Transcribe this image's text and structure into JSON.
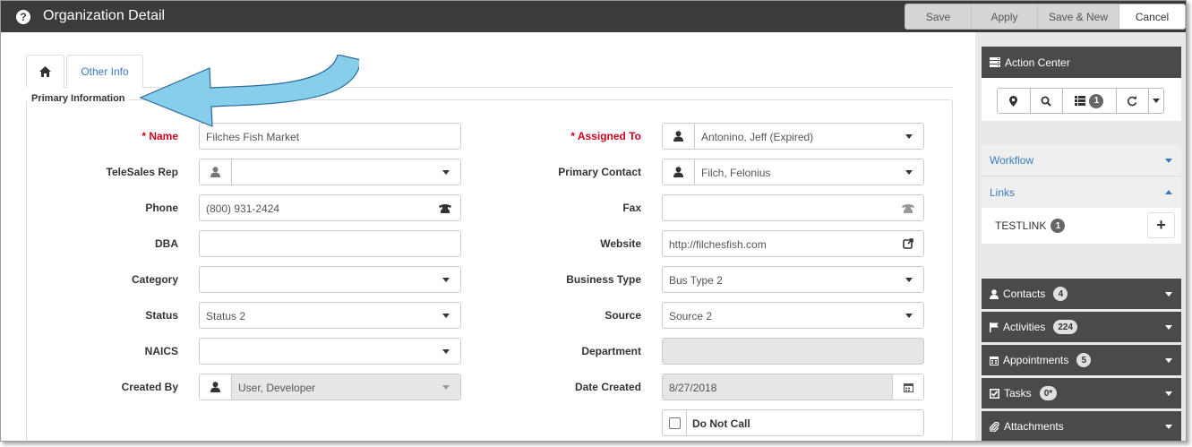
{
  "window": {
    "title": "Organization Detail"
  },
  "toolbar": {
    "save_label": "Save",
    "apply_label": "Apply",
    "save_new_label": "Save & New",
    "cancel_label": "Cancel"
  },
  "tabs": [
    {
      "icon": "home-icon",
      "label": ""
    },
    {
      "label": "Other Info"
    }
  ],
  "section": {
    "legend": "Primary Information"
  },
  "form": {
    "name": {
      "label": "* Name",
      "value": "Filches Fish Market"
    },
    "telesales": {
      "label": "TeleSales Rep",
      "value": ""
    },
    "phone": {
      "label": "Phone",
      "value": "(800) 931-2424"
    },
    "dba": {
      "label": "DBA",
      "value": ""
    },
    "category": {
      "label": "Category",
      "value": ""
    },
    "status": {
      "label": "Status",
      "value": "Status 2"
    },
    "naics": {
      "label": "NAICS",
      "value": ""
    },
    "created_by": {
      "label": "Created By",
      "value": "User, Developer"
    },
    "assigned_to": {
      "label": "* Assigned To",
      "value": "Antonino, Jeff (Expired)"
    },
    "primary_contact": {
      "label": "Primary Contact",
      "value": "Filch, Felonius"
    },
    "fax": {
      "label": "Fax",
      "value": ""
    },
    "website": {
      "label": "Website",
      "value": "http://filchesfish.com"
    },
    "business_type": {
      "label": "Business Type",
      "value": "Bus Type 2"
    },
    "source": {
      "label": "Source",
      "value": "Source 2"
    },
    "department": {
      "label": "Department",
      "value": ""
    },
    "date_created": {
      "label": "Date Created",
      "value": "8/27/2018"
    },
    "do_not_call": {
      "label": "Do Not Call",
      "checked": false
    }
  },
  "action_center": {
    "title": "Action Center",
    "list_badge": "1",
    "workflow_label": "Workflow",
    "links_label": "Links",
    "link_item": {
      "label": "TESTLINK",
      "badge": "1"
    },
    "sections": [
      {
        "label": "Contacts",
        "badge": "4",
        "icon": "person-icon"
      },
      {
        "label": "Activities",
        "badge": "224",
        "icon": "flag-icon"
      },
      {
        "label": "Appointments",
        "badge": "5",
        "icon": "calendar-icon"
      },
      {
        "label": "Tasks",
        "badge": "0*",
        "icon": "checkbox-icon"
      },
      {
        "label": "Attachments",
        "badge": "",
        "icon": "paperclip-icon"
      }
    ]
  },
  "colors": {
    "titlebar": "#3b3b3b",
    "required": "#d0021b",
    "link": "#3a7bbf",
    "panel_header": "#4a4a4a",
    "arrow_fill": "#87ceeb"
  }
}
